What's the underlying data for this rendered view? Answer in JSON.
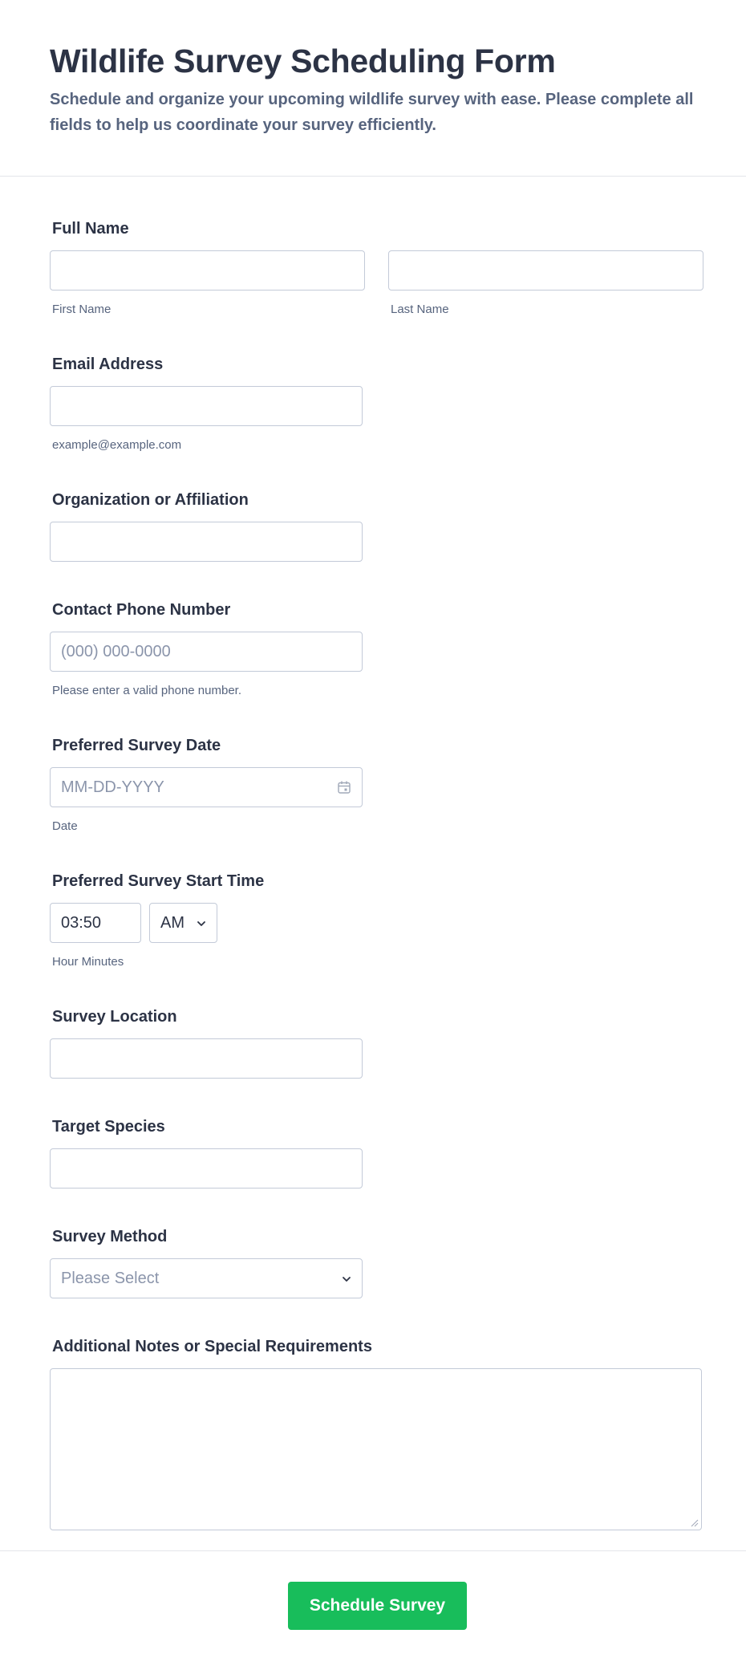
{
  "header": {
    "title": "Wildlife Survey Scheduling Form",
    "subtitle": "Schedule and organize your upcoming wildlife survey with ease. Please complete all fields to help us coordinate your survey efficiently."
  },
  "fields": {
    "full_name": {
      "label": "Full Name",
      "first_value": "",
      "first_sublabel": "First Name",
      "last_value": "",
      "last_sublabel": "Last Name"
    },
    "email": {
      "label": "Email Address",
      "value": "",
      "sublabel": "example@example.com"
    },
    "organization": {
      "label": "Organization or Affiliation",
      "value": ""
    },
    "phone": {
      "label": "Contact Phone Number",
      "placeholder": "(000) 000-0000",
      "sublabel": "Please enter a valid phone number."
    },
    "date": {
      "label": "Preferred Survey Date",
      "placeholder": "MM-DD-YYYY",
      "sublabel": "Date",
      "icon": "calendar-icon"
    },
    "start_time": {
      "label": "Preferred Survey Start Time",
      "value": "03:50",
      "ampm": "AM",
      "sublabel": "Hour Minutes"
    },
    "location": {
      "label": "Survey Location",
      "value": ""
    },
    "species": {
      "label": "Target Species",
      "value": ""
    },
    "method": {
      "label": "Survey Method",
      "selected": "Please Select"
    },
    "notes": {
      "label": "Additional Notes or Special Requirements",
      "value": ""
    }
  },
  "submit": {
    "label": "Schedule Survey"
  },
  "colors": {
    "submit": "#18bd5b",
    "border": "#c3cad8",
    "text": "#2c3345",
    "muted": "#57647e"
  }
}
